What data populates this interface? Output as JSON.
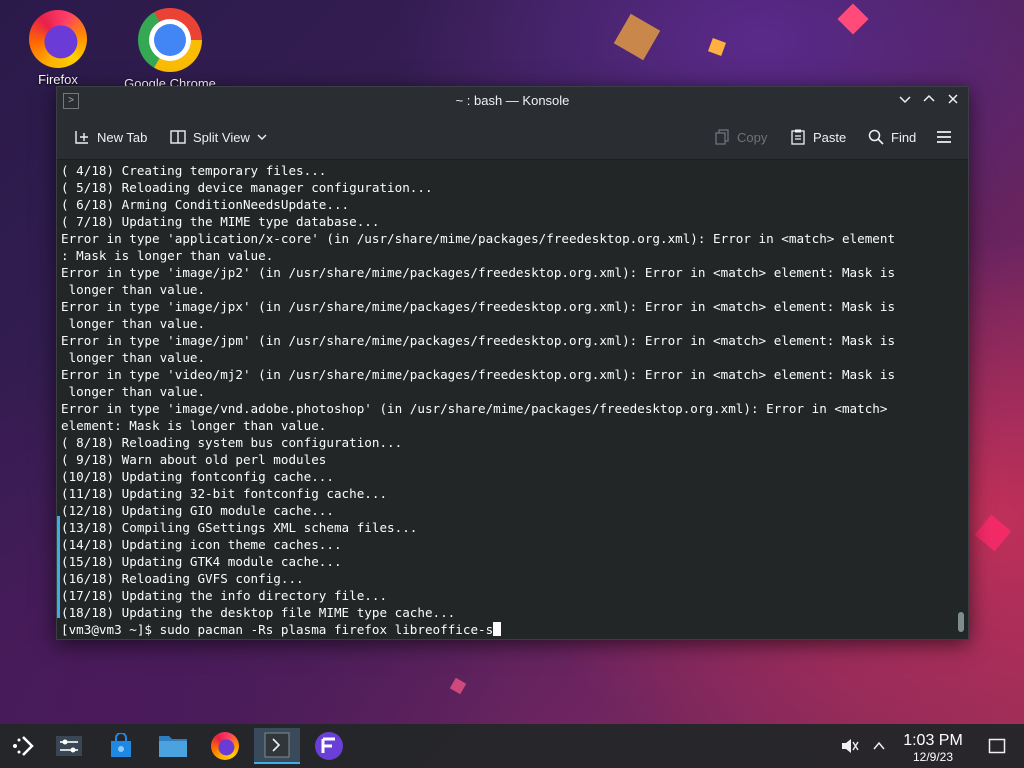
{
  "desktop": {
    "icons": [
      {
        "label": "Firefox",
        "icon": "firefox-icon"
      },
      {
        "label": "Google Chrome",
        "icon": "chrome-icon"
      }
    ]
  },
  "window": {
    "title": "~ : bash — Konsole",
    "toolbar": {
      "new_tab": "New Tab",
      "split_view": "Split View",
      "copy": "Copy",
      "paste": "Paste",
      "find": "Find"
    },
    "terminal_lines": [
      "( 4/18) Creating temporary files...",
      "( 5/18) Reloading device manager configuration...",
      "( 6/18) Arming ConditionNeedsUpdate...",
      "( 7/18) Updating the MIME type database...",
      "Error in type 'application/x-core' (in /usr/share/mime/packages/freedesktop.org.xml): Error in <match> element",
      ": Mask is longer than value.",
      "Error in type 'image/jp2' (in /usr/share/mime/packages/freedesktop.org.xml): Error in <match> element: Mask is",
      " longer than value.",
      "Error in type 'image/jpx' (in /usr/share/mime/packages/freedesktop.org.xml): Error in <match> element: Mask is",
      " longer than value.",
      "Error in type 'image/jpm' (in /usr/share/mime/packages/freedesktop.org.xml): Error in <match> element: Mask is",
      " longer than value.",
      "Error in type 'video/mj2' (in /usr/share/mime/packages/freedesktop.org.xml): Error in <match> element: Mask is",
      " longer than value.",
      "Error in type 'image/vnd.adobe.photoshop' (in /usr/share/mime/packages/freedesktop.org.xml): Error in <match>",
      "element: Mask is longer than value.",
      "( 8/18) Reloading system bus configuration...",
      "( 9/18) Warn about old perl modules",
      "(10/18) Updating fontconfig cache...",
      "(11/18) Updating 32-bit fontconfig cache...",
      "(12/18) Updating GIO module cache...",
      "(13/18) Compiling GSettings XML schema files...",
      "(14/18) Updating icon theme caches...",
      "(15/18) Updating GTK4 module cache...",
      "(16/18) Reloading GVFS config...",
      "(17/18) Updating the info directory file...",
      "(18/18) Updating the desktop file MIME type cache..."
    ],
    "prompt": "[vm3@vm3 ~]$ ",
    "command": "sudo pacman -Rs plasma firefox libreoffice-s"
  },
  "taskbar": {
    "clock_time": "1:03 PM",
    "clock_date": "12/9/23"
  },
  "colors": {
    "accent": "#3daee9",
    "terminal_bg": "#232627",
    "titlebar_bg": "#2a2e32"
  }
}
